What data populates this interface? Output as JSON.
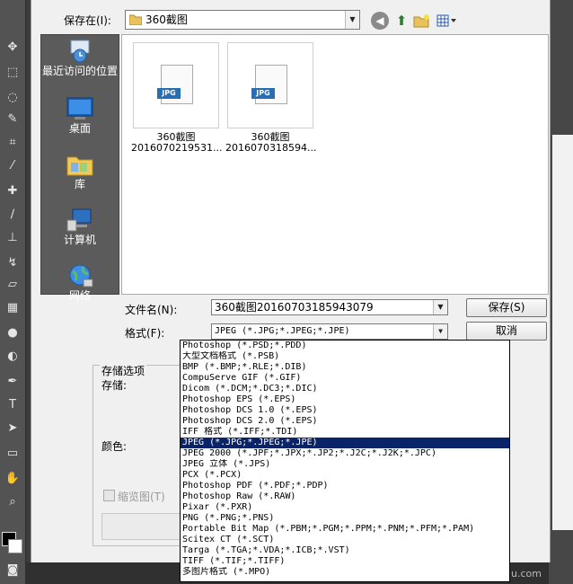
{
  "dialog": {
    "save_in_label": "保存在(I):",
    "current_folder": "360截图",
    "filename_label": "文件名(N):",
    "filename_value": "360截图20160703185943079",
    "format_label": "格式(F):",
    "format_value": "JPEG (*.JPG;*.JPEG;*.JPE)",
    "save_button": "保存(S)",
    "cancel_button": "取消",
    "options_title": "存储选项",
    "options_store_label": "存储:",
    "color_label": "颜色:",
    "thumbnail_label": "缩览图(T)"
  },
  "places": [
    {
      "label": "最近访问的位置",
      "icon": "recent-places-icon"
    },
    {
      "label": "桌面",
      "icon": "desktop-icon"
    },
    {
      "label": "库",
      "icon": "libraries-icon"
    },
    {
      "label": "计算机",
      "icon": "computer-icon"
    },
    {
      "label": "网络",
      "icon": "network-icon"
    }
  ],
  "files": [
    {
      "badge": "JPG",
      "name_line1": "360截图",
      "name_line2": "2016070219531..."
    },
    {
      "badge": "JPG",
      "name_line1": "360截图",
      "name_line2": "2016070318594..."
    }
  ],
  "format_options": [
    "Photoshop (*.PSD;*.PDD)",
    "大型文档格式 (*.PSB)",
    "BMP (*.BMP;*.RLE;*.DIB)",
    "CompuServe GIF (*.GIF)",
    "Dicom (*.DCM;*.DC3;*.DIC)",
    "Photoshop EPS (*.EPS)",
    "Photoshop DCS 1.0 (*.EPS)",
    "Photoshop DCS 2.0 (*.EPS)",
    "IFF 格式 (*.IFF;*.TDI)",
    "JPEG (*.JPG;*.JPEG;*.JPE)",
    "JPEG 2000 (*.JPF;*.JPX;*.JP2;*.J2C;*.J2K;*.JPC)",
    "JPEG 立体 (*.JPS)",
    "PCX (*.PCX)",
    "Photoshop PDF (*.PDF;*.PDP)",
    "Photoshop Raw (*.RAW)",
    "Pixar (*.PXR)",
    "PNG (*.PNG;*.PNS)",
    "Portable Bit Map (*.PBM;*.PGM;*.PPM;*.PNM;*.PFM;*.PAM)",
    "Scitex CT (*.SCT)",
    "Targa (*.TGA;*.VDA;*.ICB;*.VST)",
    "TIFF (*.TIF;*.TIFF)",
    "多图片格式 (*.MPO)"
  ],
  "format_selected_index": 9,
  "watermark": "Bai du 经验 jingyan.baidu.com",
  "colors": {
    "selection": "#0a246a",
    "places_bg": "#5b5b5b",
    "jpg_badge": "#2a6db0"
  }
}
